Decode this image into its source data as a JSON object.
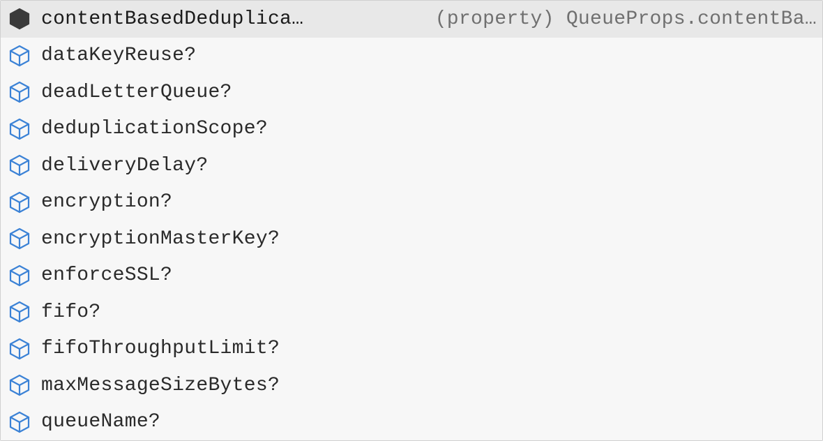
{
  "intellisense": {
    "detail_prefix": "(property) ",
    "detail_type_owner": "QueueProps",
    "detail_member": "contentBa…",
    "items": [
      {
        "label": "contentBasedDeduplica…",
        "selected": true,
        "icon_style": "filled"
      },
      {
        "label": "dataKeyReuse?",
        "selected": false,
        "icon_style": "outline"
      },
      {
        "label": "deadLetterQueue?",
        "selected": false,
        "icon_style": "outline"
      },
      {
        "label": "deduplicationScope?",
        "selected": false,
        "icon_style": "outline"
      },
      {
        "label": "deliveryDelay?",
        "selected": false,
        "icon_style": "outline"
      },
      {
        "label": "encryption?",
        "selected": false,
        "icon_style": "outline"
      },
      {
        "label": "encryptionMasterKey?",
        "selected": false,
        "icon_style": "outline"
      },
      {
        "label": "enforceSSL?",
        "selected": false,
        "icon_style": "outline"
      },
      {
        "label": "fifo?",
        "selected": false,
        "icon_style": "outline"
      },
      {
        "label": "fifoThroughputLimit?",
        "selected": false,
        "icon_style": "outline"
      },
      {
        "label": "maxMessageSizeBytes?",
        "selected": false,
        "icon_style": "outline"
      },
      {
        "label": "queueName?",
        "selected": false,
        "icon_style": "outline"
      }
    ]
  }
}
